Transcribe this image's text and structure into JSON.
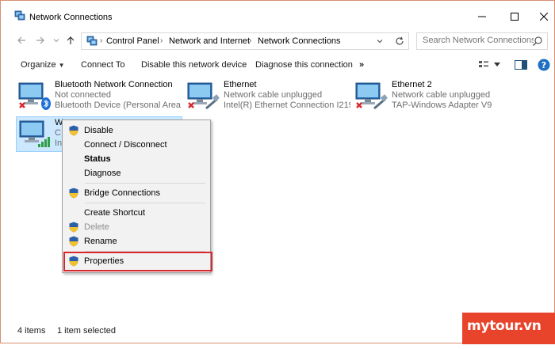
{
  "window": {
    "title": "Network Connections",
    "icon": "network-connections-icon",
    "controls": {
      "minimize": "minimize-icon",
      "maximize": "maximize-icon",
      "close": "close-icon"
    }
  },
  "address": {
    "breadcrumbs": [
      "Control Panel",
      "Network and Internet",
      "Network Connections"
    ],
    "search_placeholder": "Search Network Connections"
  },
  "toolbar": {
    "organize": "Organize",
    "connect_to": "Connect To",
    "disable_device": "Disable this network device",
    "diagnose": "Diagnose this connection",
    "more": "»"
  },
  "items": [
    {
      "name": "Bluetooth Network Connection",
      "status": "Not connected",
      "device": "Bluetooth Device (Personal Area ...",
      "overlay": "bluetooth-icon",
      "state": "error"
    },
    {
      "name": "Ethernet",
      "status": "Network cable unplugged",
      "device": "Intel(R) Ethernet Connection I219...",
      "overlay": "cable-icon",
      "state": "error"
    },
    {
      "name": "Ethernet 2",
      "status": "Network cable unplugged",
      "device": "TAP-Windows Adapter V9",
      "overlay": "cable-icon",
      "state": "error"
    },
    {
      "name": "W",
      "status": "C",
      "device": "In",
      "overlay": "wifi-signal-icon",
      "state": "selected"
    }
  ],
  "context_menu": {
    "items": [
      {
        "label": "Disable",
        "shield": true,
        "bold": false,
        "disabled": false
      },
      {
        "label": "Connect / Disconnect",
        "shield": false,
        "bold": false,
        "disabled": false
      },
      {
        "label": "Status",
        "shield": false,
        "bold": true,
        "disabled": false
      },
      {
        "label": "Diagnose",
        "shield": false,
        "bold": false,
        "disabled": false
      },
      {
        "label": "Bridge Connections",
        "shield": true,
        "bold": false,
        "disabled": false
      },
      {
        "label": "Create Shortcut",
        "shield": false,
        "bold": false,
        "disabled": false
      },
      {
        "label": "Delete",
        "shield": true,
        "bold": false,
        "disabled": true
      },
      {
        "label": "Rename",
        "shield": true,
        "bold": false,
        "disabled": false
      },
      {
        "label": "Properties",
        "shield": true,
        "bold": false,
        "disabled": false,
        "highlighted": true
      }
    ]
  },
  "statusbar": {
    "count": "4 items",
    "selected": "1 item selected"
  },
  "watermark": "mytour.vn",
  "colors": {
    "selection": "#cce8ff",
    "highlight_border": "#d9272e",
    "watermark_bg": "#e8442c",
    "error": "#d9272e",
    "wifi_green": "#2f9e44"
  }
}
